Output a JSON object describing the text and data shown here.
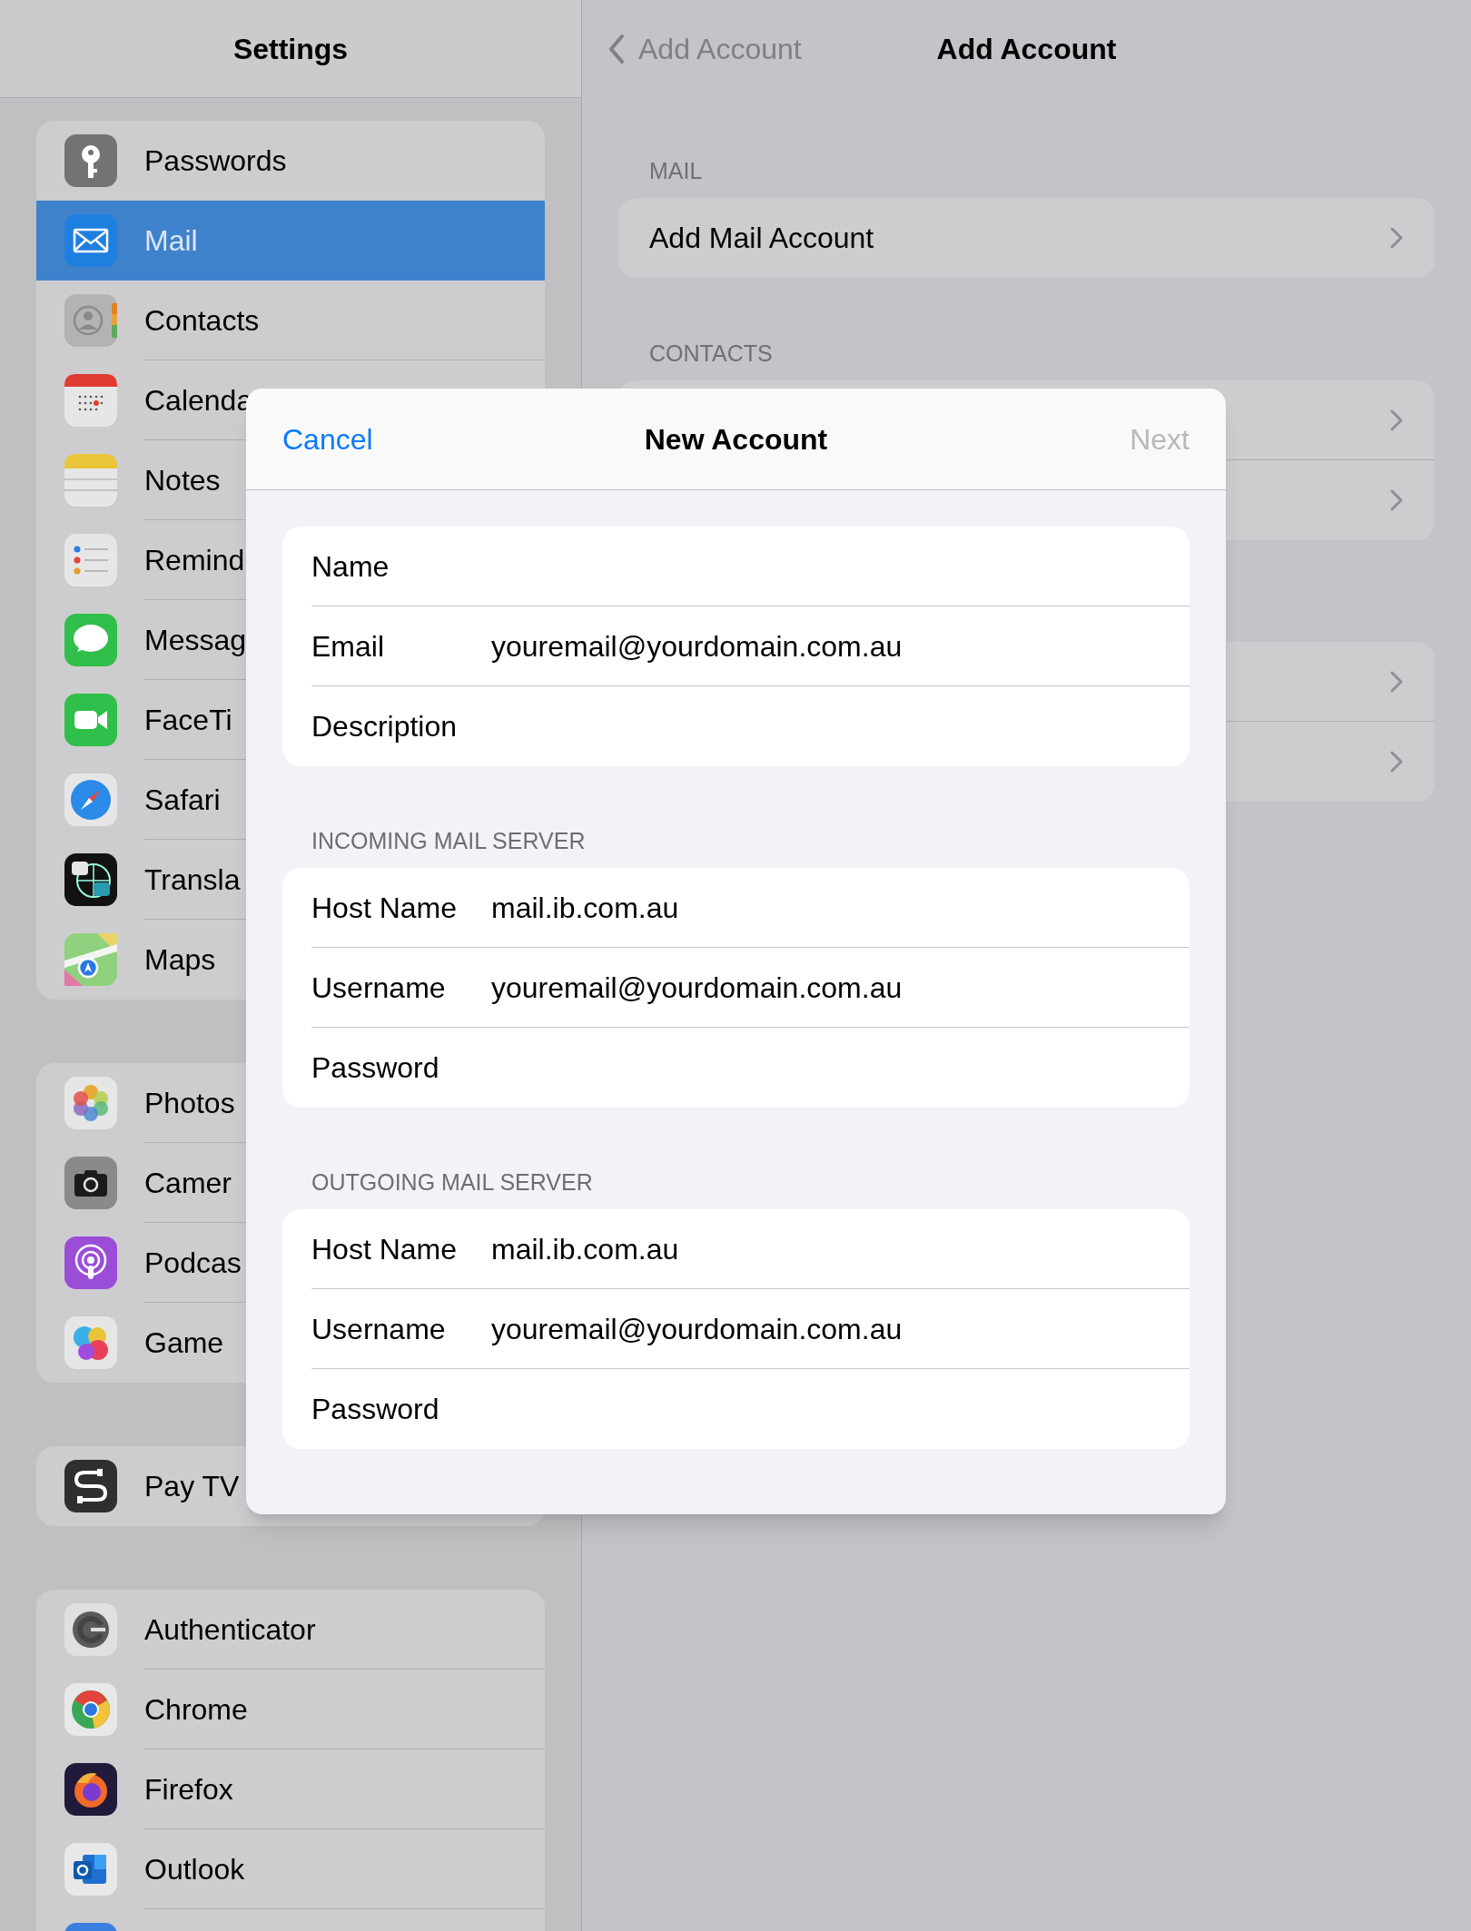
{
  "sidebar": {
    "title": "Settings",
    "groups": [
      {
        "items": [
          {
            "kind": "passwords",
            "label": "Passwords",
            "selected": false
          },
          {
            "kind": "mail",
            "label": "Mail",
            "selected": true
          },
          {
            "kind": "contacts",
            "label": "Contacts",
            "selected": false
          },
          {
            "kind": "calendar",
            "label": "Calenda",
            "selected": false
          },
          {
            "kind": "notes",
            "label": "Notes",
            "selected": false
          },
          {
            "kind": "reminders",
            "label": "Remind",
            "selected": false
          },
          {
            "kind": "messages",
            "label": "Messag",
            "selected": false
          },
          {
            "kind": "facetime",
            "label": "FaceTi",
            "selected": false
          },
          {
            "kind": "safari",
            "label": "Safari",
            "selected": false
          },
          {
            "kind": "translate",
            "label": "Transla",
            "selected": false
          },
          {
            "kind": "maps",
            "label": "Maps",
            "selected": false
          }
        ]
      },
      {
        "items": [
          {
            "kind": "photos",
            "label": "Photos",
            "selected": false
          },
          {
            "kind": "camera",
            "label": "Camer",
            "selected": false
          },
          {
            "kind": "podcasts",
            "label": "Podcas",
            "selected": false
          },
          {
            "kind": "gamecenter",
            "label": "Game",
            "selected": false
          }
        ]
      },
      {
        "items": [
          {
            "kind": "paytv",
            "label": "Pay TV",
            "selected": false
          }
        ]
      },
      {
        "items": [
          {
            "kind": "authenticator",
            "label": "Authenticator",
            "selected": false
          },
          {
            "kind": "chrome",
            "label": "Chrome",
            "selected": false
          },
          {
            "kind": "firefox",
            "label": "Firefox",
            "selected": false
          },
          {
            "kind": "outlook",
            "label": "Outlook",
            "selected": false
          },
          {
            "kind": "blueapp",
            "selected": false
          }
        ]
      }
    ]
  },
  "detail": {
    "back_label": "Add Account",
    "title": "Add Account",
    "sections": [
      {
        "header": "MAIL",
        "rows": [
          {
            "label": "Add Mail Account",
            "chevron": true
          }
        ]
      },
      {
        "header": "CONTACTS",
        "rows": [
          {
            "chevron": true
          },
          {
            "chevron": true
          }
        ]
      },
      {
        "rows": [
          {
            "chevron": true
          },
          {
            "chevron": true
          }
        ]
      }
    ]
  },
  "modal": {
    "cancel": "Cancel",
    "title": "New Account",
    "next": {
      "label": "Next",
      "disabled": true
    },
    "sections": [
      {
        "rows": [
          {
            "label": "Name"
          },
          {
            "label": "Email",
            "value": "youremail@yourdomain.com.au"
          },
          {
            "label": "Description"
          }
        ]
      },
      {
        "header": "INCOMING MAIL SERVER",
        "rows": [
          {
            "label": "Host Name",
            "value": "mail.ib.com.au"
          },
          {
            "label": "Username",
            "value": "youremail@yourdomain.com.au"
          },
          {
            "label": "Password"
          }
        ]
      },
      {
        "header": "OUTGOING MAIL SERVER",
        "rows": [
          {
            "label": "Host Name",
            "value": "mail.ib.com.au"
          },
          {
            "label": "Username",
            "value": "youremail@yourdomain.com.au"
          },
          {
            "label": "Password"
          }
        ]
      }
    ]
  }
}
